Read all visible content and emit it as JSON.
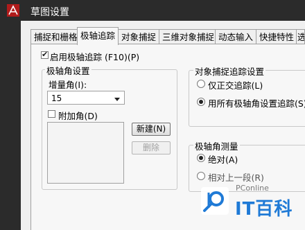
{
  "window": {
    "title": "草图设置"
  },
  "tabs": [
    {
      "label": "捕捉和栅格",
      "active": false
    },
    {
      "label": "极轴追踪",
      "active": true
    },
    {
      "label": "对象捕捉",
      "active": false
    },
    {
      "label": "三维对象捕捉",
      "active": false
    },
    {
      "label": "动态输入",
      "active": false
    },
    {
      "label": "快捷特性",
      "active": false
    },
    {
      "label": "选",
      "active": false
    }
  ],
  "enable_polar": {
    "label": "启用极轴追踪 (F10)(P)",
    "checked": true
  },
  "polar_angle_settings": {
    "title": "极轴角设置",
    "increment_label": "增量角(I):",
    "increment_value": "15",
    "additional_label": "附加角(D)",
    "additional_checked": false,
    "new_button": "新建(N)",
    "delete_button": "删除"
  },
  "object_snap_tracking": {
    "title": "对象捕捉追踪设置",
    "orthogonal_label": "仅正交追踪(L)",
    "all_polar_label": "用所有极轴角设置追踪(S)",
    "selected": "all_polar"
  },
  "polar_angle_measurement": {
    "title": "极轴角测量",
    "absolute_label": "绝对(A)",
    "relative_label": "相对上一段(R)",
    "selected": "absolute"
  },
  "watermark": {
    "brand_small": "PConline",
    "brand_large": "IT百科"
  },
  "colors": {
    "titlebar": "#2b2b2b",
    "watermark_blue": "#1f7ad6"
  },
  "icons": {
    "app": "autocad-logo-icon",
    "watermark": "pconline-logo-icon"
  }
}
